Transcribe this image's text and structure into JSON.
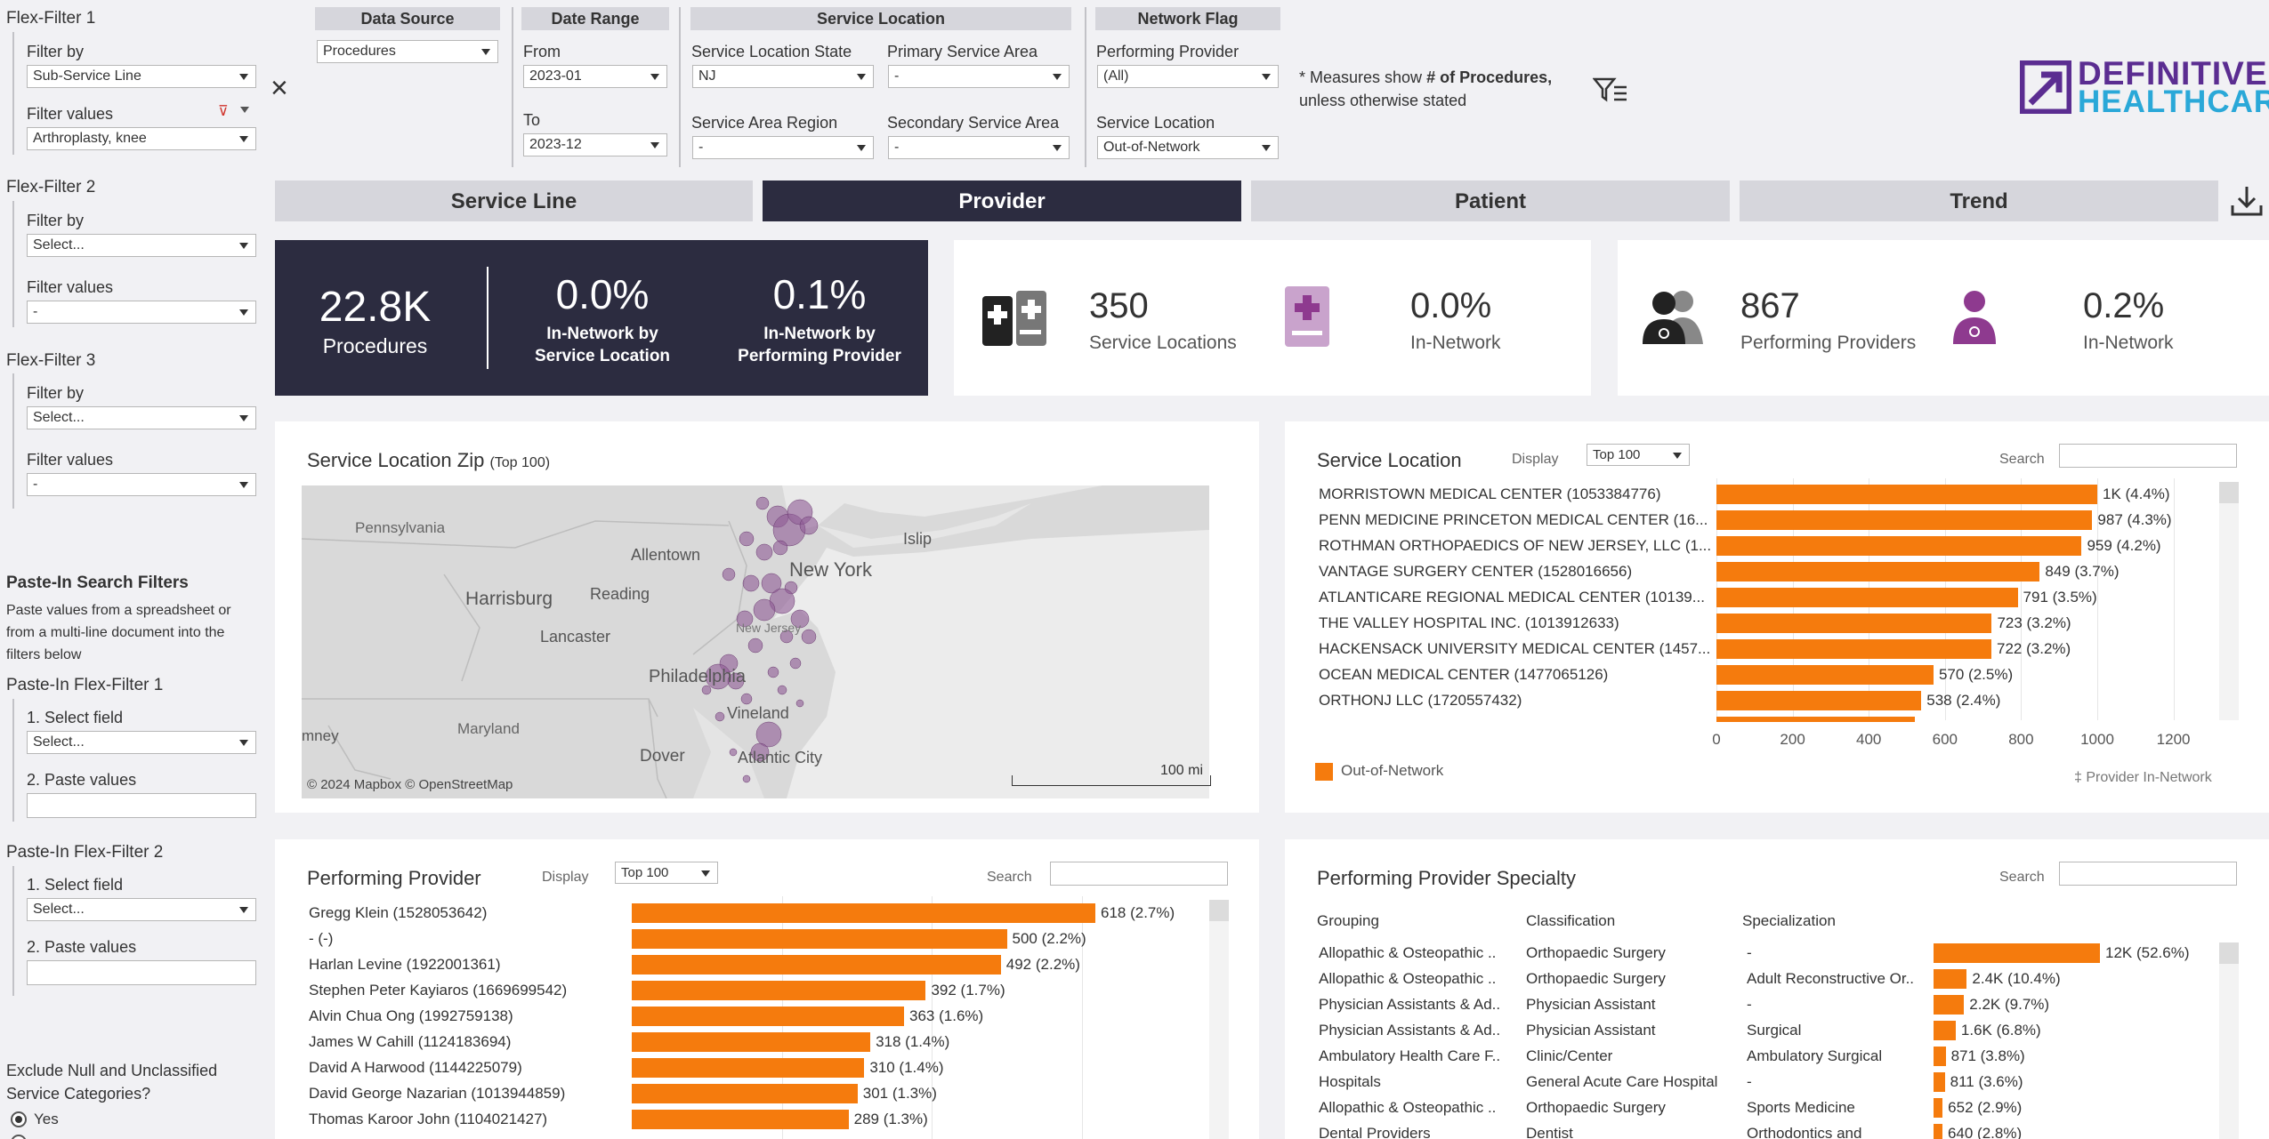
{
  "flex_filters": [
    {
      "title": "Flex-Filter 1",
      "filter_by_label": "Filter by",
      "filter_by_value": "Sub-Service Line",
      "filter_values_label": "Filter values",
      "filter_values_value": "Arthroplasty, knee"
    },
    {
      "title": "Flex-Filter 2",
      "filter_by_label": "Filter by",
      "filter_by_value": "Select...",
      "filter_values_label": "Filter values",
      "filter_values_value": "-"
    },
    {
      "title": "Flex-Filter 3",
      "filter_by_label": "Filter by",
      "filter_by_value": "Select...",
      "filter_values_label": "Filter values",
      "filter_values_value": "-"
    }
  ],
  "paste_in": {
    "title": "Paste-In Search Filters",
    "description": [
      "Paste values from a spreadsheet or",
      "from a multi-line document into the",
      "filters below"
    ],
    "filters": [
      {
        "title": "Paste-In Flex-Filter 1",
        "select_label": "1. Select field",
        "select_value": "Select...",
        "paste_label": "2. Paste values"
      },
      {
        "title": "Paste-In Flex-Filter 2",
        "select_label": "1. Select field",
        "select_value": "Select...",
        "paste_label": "2. Paste values"
      }
    ]
  },
  "exclude": {
    "title_1": "Exclude Null and Unclassified",
    "title_2": "Service Categories?",
    "option_yes": "Yes"
  },
  "top_filters": {
    "data_source": {
      "header": "Data Source",
      "value": "Procedures"
    },
    "date_range": {
      "header": "Date Range",
      "from_label": "From",
      "from_value": "2023-01",
      "to_label": "To",
      "to_value": "2023-12"
    },
    "service_location": {
      "header": "Service Location",
      "state_label": "Service Location State",
      "state_value": "NJ",
      "psa_label": "Primary Service Area",
      "psa_value": "-",
      "region_label": "Service Area Region",
      "region_value": "-",
      "ssa_label": "Secondary Service Area",
      "ssa_value": "-"
    },
    "network_flag": {
      "header": "Network Flag",
      "pp_label": "Performing Provider",
      "pp_value": "(All)",
      "sl_label": "Service Location",
      "sl_value": "Out-of-Network"
    }
  },
  "note": {
    "prefix": "* Measures show ",
    "bold": "# of Procedures,",
    "line2": "unless otherwise stated"
  },
  "logo": {
    "line1": "DEFINITIVE",
    "line2": "HEALTHCARE"
  },
  "tabs": [
    "Service Line",
    "Provider",
    "Patient",
    "Trend"
  ],
  "kpis": {
    "procedures_value": "22.8K",
    "procedures_label": "Procedures",
    "in_net_sl_value": "0.0%",
    "in_net_sl_label_1": "In-Network by",
    "in_net_sl_label_2": "Service Location",
    "in_net_pp_value": "0.1%",
    "in_net_pp_label_1": "In-Network by",
    "in_net_pp_label_2": "Performing Provider",
    "sl_count": "350",
    "sl_count_label": "Service Locations",
    "sl_in_net": "0.0%",
    "sl_in_net_label": "In-Network",
    "pp_count": "867",
    "pp_count_label": "Performing Providers",
    "pp_in_net": "0.2%",
    "pp_in_net_label": "In-Network"
  },
  "map": {
    "title": "Service Location Zip",
    "title_suffix": "(Top 100)",
    "places": [
      "Pennsylvania",
      "Allentown",
      "Islip",
      "New York",
      "Harrisburg",
      "Reading",
      "Lancaster",
      "Philadelphia",
      "Vineland",
      "Maryland",
      "mney",
      "Dover",
      "Atlantic City",
      "New Jersey"
    ],
    "scale": "100 mi",
    "attribution": "© 2024 Mapbox  © OpenStreetMap"
  },
  "service_location_panel": {
    "title": "Service Location",
    "display_label": "Display",
    "display_value": "Top 100",
    "search_label": "Search",
    "legend_label": "Out-of-Network",
    "footer": "‡ Provider In-Network"
  },
  "performing_provider_panel": {
    "title": "Performing Provider",
    "display_label": "Display",
    "display_value": "Top 100",
    "search_label": "Search"
  },
  "specialty_panel": {
    "title": "Performing Provider Specialty",
    "search_label": "Search",
    "col_grouping": "Grouping",
    "col_classification": "Classification",
    "col_specialization": "Specialization"
  },
  "chart_data": [
    {
      "type": "bar",
      "orientation": "horizontal",
      "title": "Service Location",
      "categories": [
        "MORRISTOWN MEDICAL CENTER (1053384776)",
        "PENN MEDICINE PRINCETON MEDICAL CENTER (16...",
        "ROTHMAN ORTHOPAEDICS OF NEW JERSEY, LLC (1...",
        "VANTAGE SURGERY CENTER (1528016656)",
        "ATLANTICARE REGIONAL MEDICAL CENTER (10139...",
        "THE VALLEY HOSPITAL INC. (1013912633)",
        "HACKENSACK UNIVERSITY MEDICAL CENTER (1457...",
        "OCEAN MEDICAL CENTER (1477065126)",
        "ORTHONJ LLC (1720557432)"
      ],
      "values": [
        1000,
        987,
        959,
        849,
        791,
        723,
        722,
        570,
        538
      ],
      "labels": [
        "1K (4.4%)",
        "987 (4.3%)",
        "959 (4.2%)",
        "849 (3.7%)",
        "791 (3.5%)",
        "723 (3.2%)",
        "722 (3.2%)",
        "570 (2.5%)",
        "538 (2.4%)"
      ],
      "xlim": [
        0,
        1200
      ],
      "xticks": [
        0,
        200,
        400,
        600,
        800,
        1000,
        1200
      ],
      "series": [
        {
          "name": "Out-of-Network",
          "color": "#f57b0d"
        }
      ]
    },
    {
      "type": "bar",
      "orientation": "horizontal",
      "title": "Performing Provider",
      "categories": [
        "Gregg Klein (1528053642)",
        "- (-)",
        "Harlan Levine (1922001361)",
        "Stephen Peter Kayiaros (1669699542)",
        "Alvin Chua Ong (1992759138)",
        "James W Cahill (1124183694)",
        "David A Harwood (1144225079)",
        "David George Nazarian (1013944859)",
        "Thomas Karoor John (1104021427)"
      ],
      "values": [
        618,
        500,
        492,
        392,
        363,
        318,
        310,
        301,
        289
      ],
      "labels": [
        "618 (2.7%)",
        "500 (2.2%)",
        "492 (2.2%)",
        "392 (1.7%)",
        "363 (1.6%)",
        "318 (1.4%)",
        "310 (1.4%)",
        "301 (1.3%)",
        "289 (1.3%)"
      ],
      "xlim": [
        0,
        700
      ]
    },
    {
      "type": "bar",
      "orientation": "horizontal",
      "title": "Performing Provider Specialty",
      "rows": [
        {
          "grouping": "Allopathic & Osteopathic ..",
          "classification": "Orthopaedic Surgery",
          "specialization": "-",
          "value": 12000,
          "label": "12K (52.6%)"
        },
        {
          "grouping": "Allopathic & Osteopathic ..",
          "classification": "Orthopaedic Surgery",
          "specialization": "Adult Reconstructive Or..",
          "value": 2400,
          "label": "2.4K (10.4%)"
        },
        {
          "grouping": "Physician Assistants & Ad..",
          "classification": "Physician Assistant",
          "specialization": "-",
          "value": 2200,
          "label": "2.2K (9.7%)"
        },
        {
          "grouping": "Physician Assistants & Ad..",
          "classification": "Physician Assistant",
          "specialization": "Surgical",
          "value": 1600,
          "label": "1.6K (6.8%)"
        },
        {
          "grouping": "Ambulatory Health Care F..",
          "classification": "Clinic/Center",
          "specialization": "Ambulatory Surgical",
          "value": 871,
          "label": "871 (3.8%)"
        },
        {
          "grouping": "Hospitals",
          "classification": "General Acute Care Hospital",
          "specialization": "-",
          "value": 811,
          "label": "811 (3.6%)"
        },
        {
          "grouping": "Allopathic & Osteopathic ..",
          "classification": "Orthopaedic Surgery",
          "specialization": "Sports Medicine",
          "value": 652,
          "label": "652 (2.9%)"
        },
        {
          "grouping": "Dental Providers",
          "classification": "Dentist",
          "specialization": "Orthodontics and",
          "value": 640,
          "label": "640 (2.8%)"
        }
      ]
    }
  ]
}
